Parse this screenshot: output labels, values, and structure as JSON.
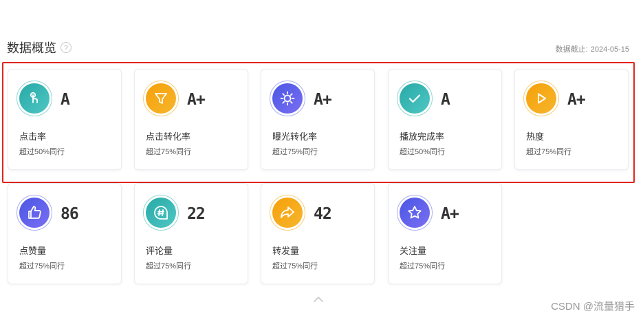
{
  "header": {
    "title": "数据概览",
    "help_icon": "?",
    "date_prefix": "数据截止:",
    "date": "2024-05-15"
  },
  "cards": [
    {
      "label": "点击率",
      "grade": "A",
      "sub": "超过50%同行",
      "color": "teal",
      "icon": "tap-icon"
    },
    {
      "label": "点击转化率",
      "grade": "A+",
      "sub": "超过75%同行",
      "color": "orange",
      "icon": "filter-icon"
    },
    {
      "label": "曝光转化率",
      "grade": "A+",
      "sub": "超过75%同行",
      "color": "purple",
      "icon": "sun-icon"
    },
    {
      "label": "播放完成率",
      "grade": "A",
      "sub": "超过50%同行",
      "color": "teal",
      "icon": "check-icon"
    },
    {
      "label": "热度",
      "grade": "A+",
      "sub": "超过75%同行",
      "color": "orange",
      "icon": "play-icon"
    },
    {
      "label": "点赞量",
      "grade": "86",
      "sub": "超过75%同行",
      "color": "purple",
      "icon": "thumbs-up-icon"
    },
    {
      "label": "评论量",
      "grade": "22",
      "sub": "超过75%同行",
      "color": "teal",
      "icon": "comment-hash-icon"
    },
    {
      "label": "转发量",
      "grade": "42",
      "sub": "超过75%同行",
      "color": "orange",
      "icon": "share-icon"
    },
    {
      "label": "关注量",
      "grade": "A+",
      "sub": "超过75%同行",
      "color": "purple",
      "icon": "star-icon"
    }
  ],
  "colors": {
    "teal": "#27a9a7",
    "orange": "#f5a10a",
    "purple": "#4a56e3",
    "highlight": "#e0251c"
  },
  "watermark": "CSDN @流量猎手"
}
